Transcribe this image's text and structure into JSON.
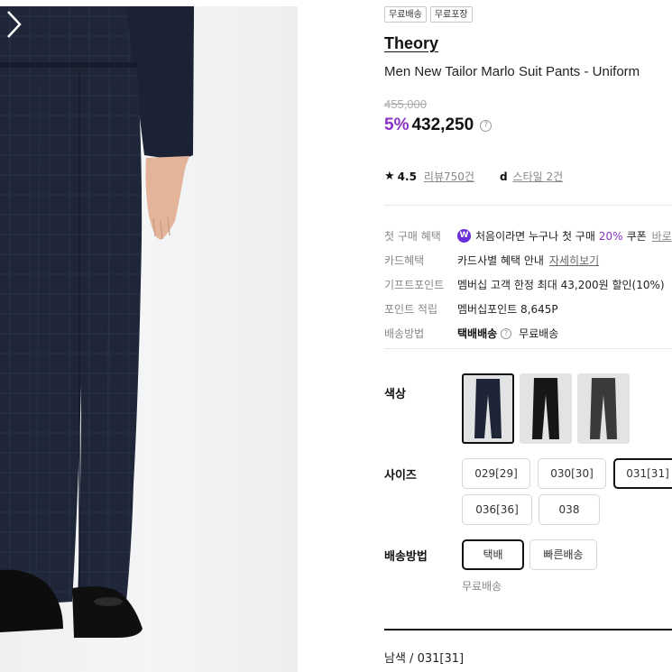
{
  "product": {
    "tags": [
      "무료배송",
      "무료포장"
    ],
    "brand": "Theory",
    "name": "Men New Tailor Marlo Suit Pants - Uniform",
    "original_price": "455,000",
    "discount": "5%",
    "price": "432,250",
    "price_help": "?",
    "rating": "4.5",
    "review_link": "리뷰750건",
    "style_link": "스타일 2건"
  },
  "info": [
    {
      "label": "첫 구매 혜택",
      "icon": "W",
      "pre": "처음이라면 누구나 첫 구매",
      "highlight": "20%",
      "post": "쿠폰",
      "extra": "바로"
    },
    {
      "label": "카드혜택",
      "text": "카드사별 혜택 안내",
      "link": "자세히보기"
    },
    {
      "label": "기프트포인트",
      "text": "멤버십 고객 한정 최대 43,200원 할인(10%)"
    },
    {
      "label": "포인트 적립",
      "text": "멤버십포인트 8,645P"
    },
    {
      "label": "배송방법",
      "bold": "택배배송",
      "help": "?",
      "text": "무료배송"
    }
  ],
  "options": {
    "color_label": "색상",
    "size_label": "사이즈",
    "sizes": [
      "029[29]",
      "030[30]",
      "031[31]",
      "036[36]",
      "038"
    ],
    "selected_size": "031[31]",
    "shipping_label": "배송방법",
    "shipping_methods": [
      "택배",
      "빠른배송"
    ],
    "selected_shipping": "택배",
    "shipping_sub": "무료배송"
  },
  "selection_summary": "남색 / 031[31]",
  "colors": {
    "accent": "#8a32c4",
    "navy": "#1d2536",
    "black": "#161616",
    "charcoal": "#3a3a3c"
  }
}
